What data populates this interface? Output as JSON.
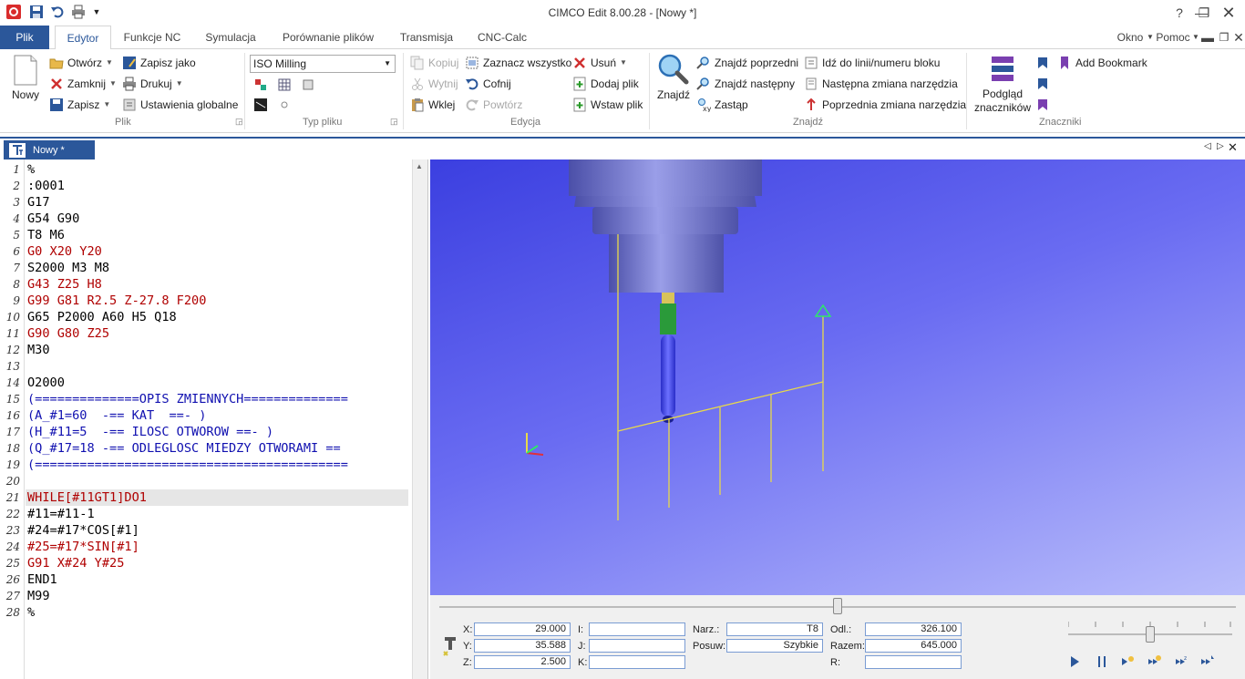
{
  "window": {
    "title": "CIMCO Edit 8.00.28 - [Nowy *]"
  },
  "colors": {
    "accent": "#2b579a",
    "code_red": "#b00000",
    "code_blue": "#1010b0",
    "code_black": "#000000"
  },
  "tabs": [
    {
      "label": "Plik",
      "state": "file"
    },
    {
      "label": "Edytor",
      "state": "active"
    },
    {
      "label": "Funkcje NC"
    },
    {
      "label": "Symulacja"
    },
    {
      "label": "Porównanie plików"
    },
    {
      "label": "Transmisja"
    },
    {
      "label": "CNC-Calc"
    }
  ],
  "menu_right": {
    "window": "Okno",
    "help": "Pomoc"
  },
  "ribbon": {
    "plik": {
      "group": "Plik",
      "new": "Nowy",
      "open": "Otwórz",
      "close": "Zamknij",
      "save": "Zapisz",
      "save_as": "Zapisz jako",
      "print": "Drukuj",
      "global_settings": "Ustawienia globalne"
    },
    "typ": {
      "group": "Typ pliku",
      "file_type": "ISO Milling"
    },
    "edycja": {
      "group": "Edycja",
      "copy": "Kopiuj",
      "cut": "Wytnij",
      "paste": "Wklej",
      "select_all": "Zaznacz wszystko",
      "undo": "Cofnij",
      "redo": "Powtórz",
      "delete": "Usuń",
      "add_file": "Dodaj plik",
      "insert_file": "Wstaw plik"
    },
    "znajdz": {
      "group": "Znajdź",
      "find": "Znajdź",
      "find_prev": "Znajdź poprzedni",
      "find_next": "Znajdź następny",
      "replace": "Zastąp",
      "goto_line": "Idź do linii/numeru bloku",
      "next_tool": "Następna zmiana narzędzia",
      "prev_tool": "Poprzednia zmiana narzędzia"
    },
    "znaczniki": {
      "group": "Znaczniki",
      "preview_l1": "Podgląd",
      "preview_l2": "znaczników",
      "add_bookmark": "Add Bookmark"
    }
  },
  "document_tab": {
    "label": "Nowy *"
  },
  "code_lines": [
    {
      "n": "1",
      "text": "%",
      "c": "k"
    },
    {
      "n": "2",
      "text": ":0001",
      "c": "k"
    },
    {
      "n": "3",
      "text": "G17",
      "c": "k"
    },
    {
      "n": "4",
      "text": "G54 G90",
      "c": "k"
    },
    {
      "n": "5",
      "text": "T8 M6",
      "c": "k"
    },
    {
      "n": "6",
      "text": "G0 X20 Y20",
      "c": "r"
    },
    {
      "n": "7",
      "text": "S2000 M3 M8",
      "c": "k"
    },
    {
      "n": "8",
      "text": "G43 Z25 H8",
      "c": "r"
    },
    {
      "n": "9",
      "text": "G99 G81 R2.5 Z-27.8 F200",
      "c": "r"
    },
    {
      "n": "10",
      "text": "G65 P2000 A60 H5 Q18",
      "c": "k"
    },
    {
      "n": "11",
      "text": "G90 G80 Z25",
      "c": "r"
    },
    {
      "n": "12",
      "text": "M30",
      "c": "k"
    },
    {
      "n": "13",
      "text": "",
      "c": "k"
    },
    {
      "n": "14",
      "text": "O2000",
      "c": "k"
    },
    {
      "n": "15",
      "text": "(==============OPIS ZMIENNYCH==============",
      "c": "b"
    },
    {
      "n": "16",
      "text": "(A_#1=60  -== KAT  ==- )",
      "c": "b"
    },
    {
      "n": "17",
      "text": "(H_#11=5  -== ILOSC OTWOROW ==- )",
      "c": "b"
    },
    {
      "n": "18",
      "text": "(Q_#17=18 -== ODLEGLOSC MIEDZY OTWORAMI ==",
      "c": "b"
    },
    {
      "n": "19",
      "text": "(==========================================",
      "c": "b"
    },
    {
      "n": "20",
      "text": "",
      "c": "k"
    },
    {
      "n": "21",
      "text": "WHILE[#11GT1]DO1",
      "c": "r"
    },
    {
      "n": "22",
      "text": "#11=#11-1",
      "c": "k"
    },
    {
      "n": "23",
      "text": "#24=#17*COS[#1]",
      "c": "k"
    },
    {
      "n": "24",
      "text": "#25=#17*SIN[#1]",
      "c": "r"
    },
    {
      "n": "25",
      "text": "G91 X#24 Y#25",
      "c": "r"
    },
    {
      "n": "26",
      "text": "END1",
      "c": "k"
    },
    {
      "n": "27",
      "text": "M99",
      "c": "k"
    },
    {
      "n": "28",
      "text": "%",
      "c": "k"
    }
  ],
  "current_line": 21,
  "coords": {
    "x_label": "X:",
    "x": "29.000",
    "y_label": "Y:",
    "y": "35.588",
    "z_label": "Z:",
    "z": "2.500",
    "i_label": "I:",
    "j_label": "J:",
    "k_label": "K:",
    "tool_label": "Narz.:",
    "tool": "T8",
    "feed_label": "Posuw:",
    "feed": "Szybkie",
    "dist_label": "Odl.:",
    "dist": "326.100",
    "total_label": "Razem:",
    "total": "645.000",
    "r_label": "R:"
  },
  "sim_slider_position": 0.5,
  "speed_slider_position": 0.5
}
